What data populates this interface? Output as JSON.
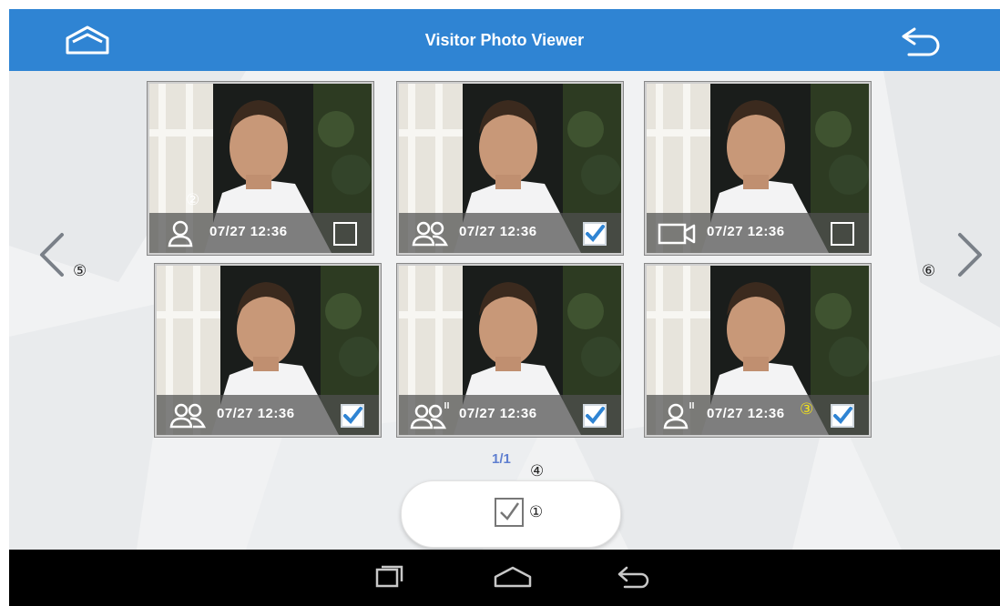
{
  "header": {
    "title": "Visitor Photo Viewer"
  },
  "thumbnails": [
    {
      "time": "07/27 12:36",
      "type": "single-visitor-icon",
      "checked": false
    },
    {
      "time": "07/27 12:36",
      "type": "multi-visitor-icon",
      "checked": true
    },
    {
      "time": "07/27 12:36",
      "type": "video-camera-icon",
      "checked": false
    },
    {
      "time": "07/27 12:36",
      "type": "multi-visitor-icon",
      "checked": true
    },
    {
      "time": "07/27 12:36",
      "type": "multi-visitor-flag-icon",
      "checked": true
    },
    {
      "time": "07/27 12:36",
      "type": "single-visitor-flag-icon",
      "checked": true
    }
  ],
  "pagination": {
    "indicator": "1/1"
  },
  "callouts": {
    "c1": "①",
    "c2": "②",
    "c3": "③",
    "c4": "④",
    "c5": "⑤",
    "c6": "⑥"
  },
  "colors": {
    "topbar": "#2f84d3",
    "page_indicator": "#5f7fd0",
    "checkbox_check": "#2f84d3",
    "callout_3": "#f2e21a"
  }
}
